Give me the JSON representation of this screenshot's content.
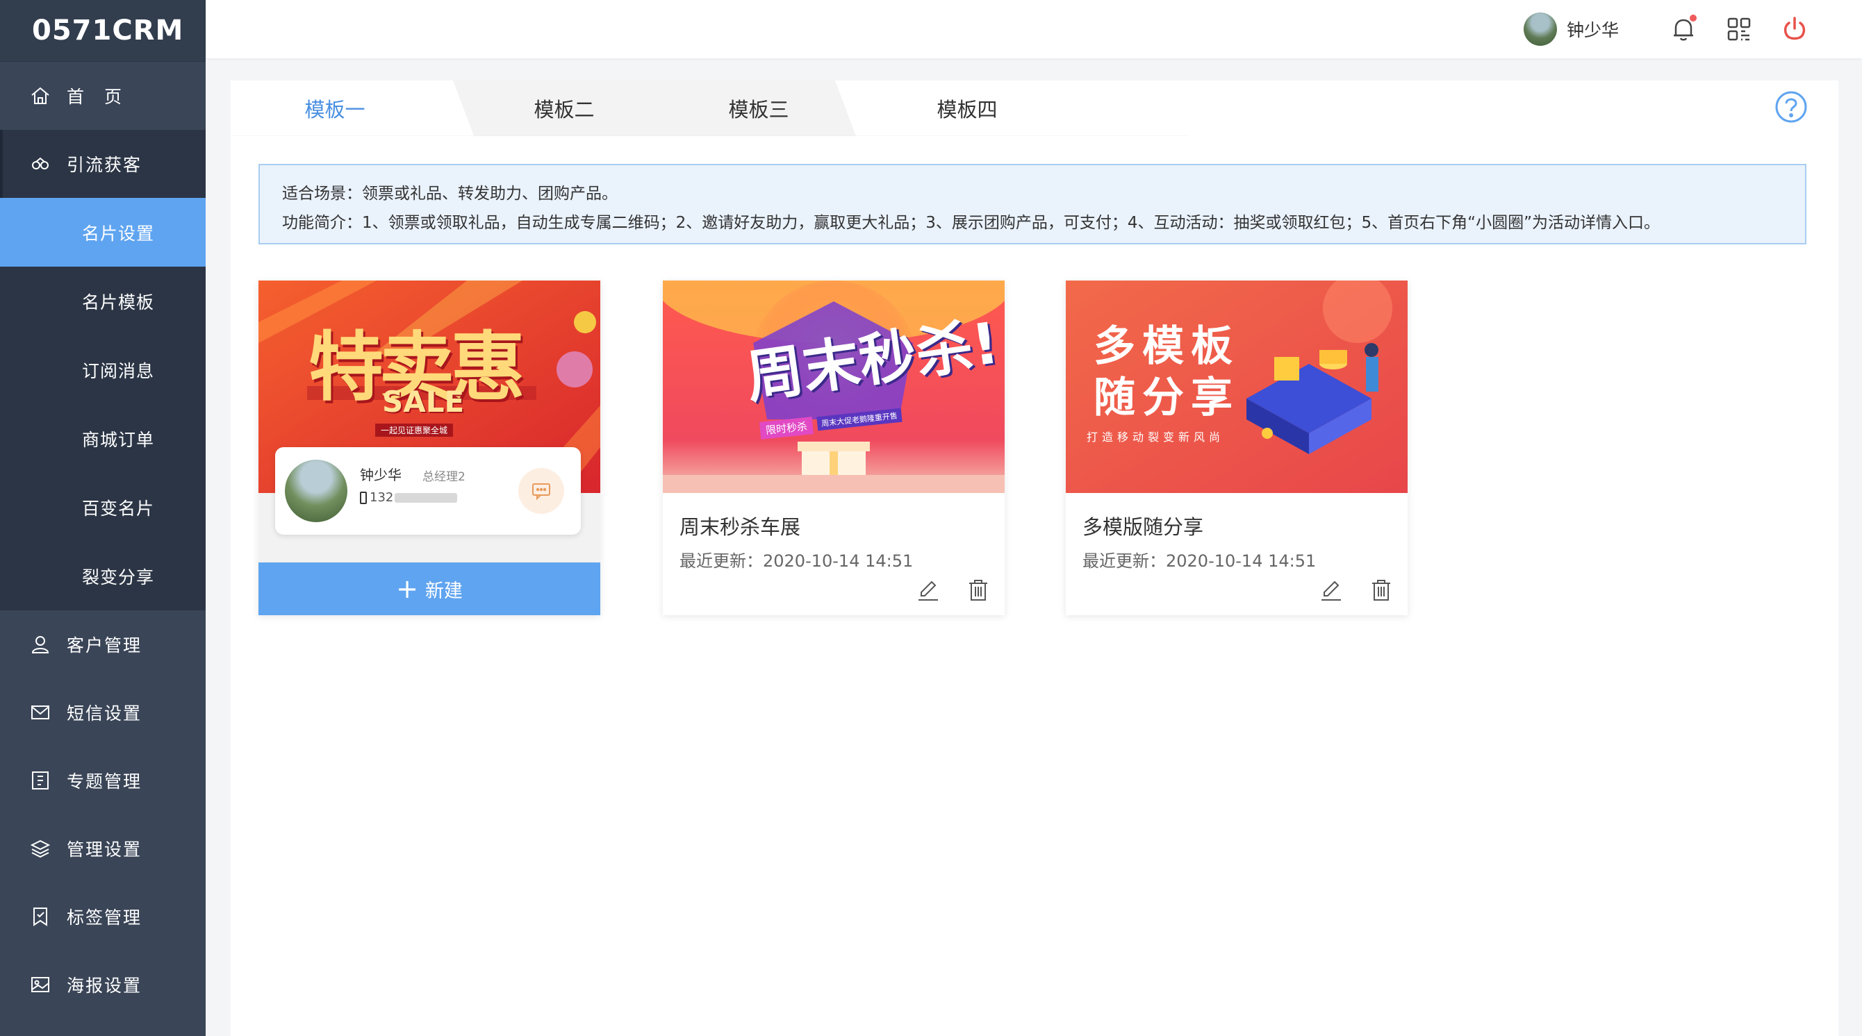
{
  "app": {
    "logo": "0571CRM"
  },
  "sidebar": {
    "items": [
      {
        "label": "首　页",
        "icon": "home-icon"
      },
      {
        "label": "引流获客",
        "icon": "link-icon"
      }
    ],
    "sub_items": [
      {
        "label": "名片设置",
        "active": true
      },
      {
        "label": "名片模板"
      },
      {
        "label": "订阅消息"
      },
      {
        "label": "商城订单"
      },
      {
        "label": "百变名片"
      },
      {
        "label": "裂变分享"
      }
    ],
    "bottom_items": [
      {
        "label": "客户管理",
        "icon": "user-icon"
      },
      {
        "label": "短信设置",
        "icon": "mail-icon"
      },
      {
        "label": "专题管理",
        "icon": "topic-icon"
      },
      {
        "label": "管理设置",
        "icon": "layers-icon"
      },
      {
        "label": "标签管理",
        "icon": "tag-icon"
      },
      {
        "label": "海报设置",
        "icon": "image-icon"
      }
    ]
  },
  "topbar": {
    "user_name": "钟少华",
    "has_notification": true
  },
  "tabs": [
    {
      "label": "模板一",
      "active": true
    },
    {
      "label": "模板二"
    },
    {
      "label": "模板三"
    },
    {
      "label": "模板四"
    }
  ],
  "info": {
    "line1": "适合场景：领票或礼品、转发助力、团购产品。",
    "line2": "功能简介：1、领票或领取礼品，自动生成专属二维码；2、邀请好友助力，赢取更大礼品；3、展示团购产品，可支付；4、互动活动：抽奖或领取红包；5、首页右下角“小圆圈”为活动详情入口。"
  },
  "new_card": {
    "banner_text": "特卖惠",
    "banner_sub": "SALE",
    "banner_tag": "一起见证惠聚全城",
    "name": "钟少华",
    "role": "总经理2",
    "phone": "132",
    "button_label": "新建"
  },
  "templates": [
    {
      "banner_title": "周末秒杀!",
      "banner_badge": "限时秒杀",
      "banner_sub": "周末大促老鹅隆重开售",
      "title": "周末秒杀车展",
      "updated": "最近更新：2020-10-14 14:51"
    },
    {
      "banner_line1": "多模板",
      "banner_line2": "随分享",
      "banner_sub": "打造移动裂变新风尚",
      "title": "多模版随分享",
      "updated": "最近更新：2020-10-14 14:51"
    }
  ],
  "colors": {
    "sidebar": "#3a4557",
    "accent": "#5fa4f0",
    "active_tab": "#4a90e2",
    "power": "#e8524a"
  }
}
